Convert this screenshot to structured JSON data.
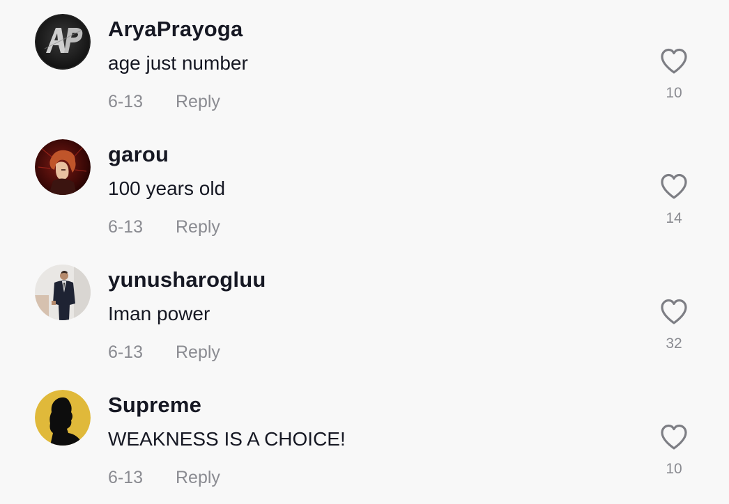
{
  "comments": [
    {
      "avatar_icon": "ap-logo-avatar",
      "username": "AryaPrayoga",
      "text": "age just number",
      "date": "6-13",
      "reply_label": "Reply",
      "likes": "10",
      "like_icon": "heart-outline-icon"
    },
    {
      "avatar_icon": "anime-character-avatar",
      "username": "garou",
      "text": "100 years old",
      "date": "6-13",
      "reply_label": "Reply",
      "likes": "14",
      "like_icon": "heart-outline-icon"
    },
    {
      "avatar_icon": "man-in-suit-avatar",
      "username": "yunusharogluu",
      "text": "Iman power",
      "date": "6-13",
      "reply_label": "Reply",
      "likes": "32",
      "like_icon": "heart-outline-icon"
    },
    {
      "avatar_icon": "silhouette-avatar",
      "username": "Supreme",
      "text": "WEAKNESS IS A CHOICE!",
      "date": "6-13",
      "reply_label": "Reply",
      "likes": "10",
      "like_icon": "heart-outline-icon"
    }
  ],
  "colors": {
    "background": "#f8f8f8",
    "primary_text": "#161823",
    "secondary_text": "#8a8b91",
    "heart_stroke": "#7d7e84",
    "supreme_avatar_bg": "#e0b93a"
  }
}
